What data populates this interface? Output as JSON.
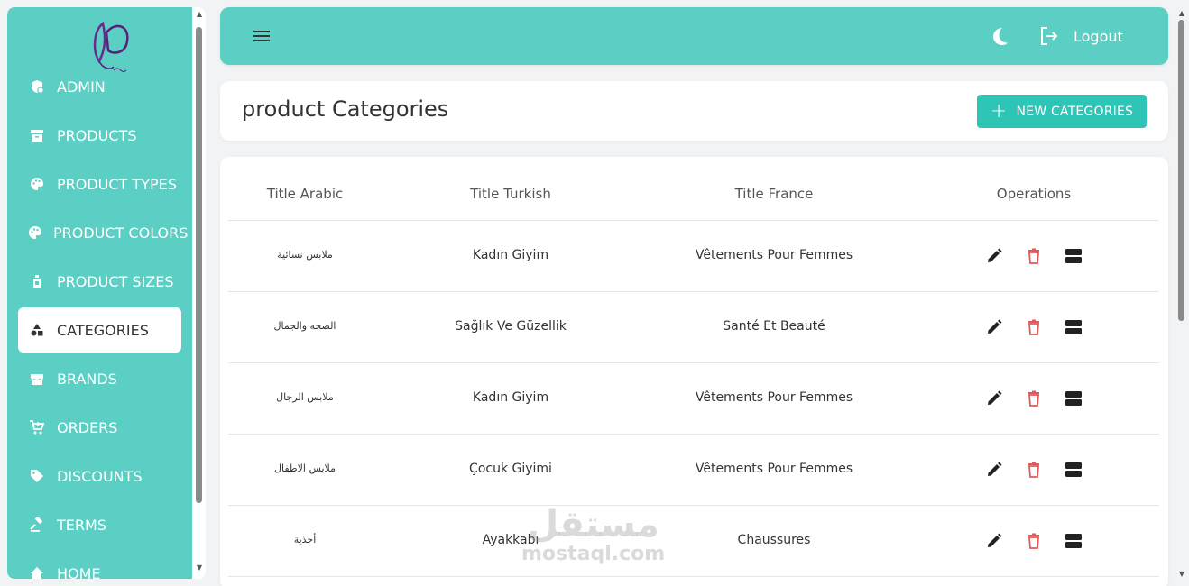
{
  "sidebar": {
    "items": [
      {
        "label": "ADMIN",
        "icon": "admin-icon"
      },
      {
        "label": "PRODUCTS",
        "icon": "archive-icon"
      },
      {
        "label": "PRODUCT TYPES",
        "icon": "palette-icon"
      },
      {
        "label": "PRODUCT COLORS",
        "icon": "palette-icon"
      },
      {
        "label": "PRODUCT SIZES",
        "icon": "bottle-icon"
      },
      {
        "label": "CATEGORIES",
        "icon": "shapes-icon",
        "active": true
      },
      {
        "label": "BRANDS",
        "icon": "store-icon"
      },
      {
        "label": "ORDERS",
        "icon": "cart-icon"
      },
      {
        "label": "DISCOUNTS",
        "icon": "tag-icon"
      },
      {
        "label": "TERMS",
        "icon": "gavel-icon"
      },
      {
        "label": "HOME",
        "icon": "home-icon"
      }
    ]
  },
  "header": {
    "logout_label": "Logout"
  },
  "page": {
    "title": "product Categories",
    "new_button_label": "NEW CATEGORIES"
  },
  "table": {
    "columns": [
      "Title Arabic",
      "Title Turkish",
      "Title France",
      "Operations"
    ],
    "rows": [
      {
        "arabic": "ملابس نسائية",
        "turkish": "Kadın Giyim",
        "france": "Vêtements Pour Femmes"
      },
      {
        "arabic": "الصحه والجمال",
        "turkish": "Sağlık Ve Güzellik",
        "france": "Santé Et Beauté"
      },
      {
        "arabic": "ملابس الرجال",
        "turkish": "Kadın Giyim",
        "france": "Vêtements Pour Femmes"
      },
      {
        "arabic": "ملابس الاطفال",
        "turkish": "Çocuk Giyimi",
        "france": "Vêtements Pour Femmes"
      },
      {
        "arabic": "أحذية",
        "turkish": "Ayakkabı",
        "france": "Chaussures"
      }
    ]
  },
  "watermark": {
    "arabic": "مستقل",
    "latin": "mostaql.com"
  },
  "colors": {
    "primary": "#5ccfc4",
    "button": "#2ec4b6",
    "delete": "#e05a5a"
  }
}
